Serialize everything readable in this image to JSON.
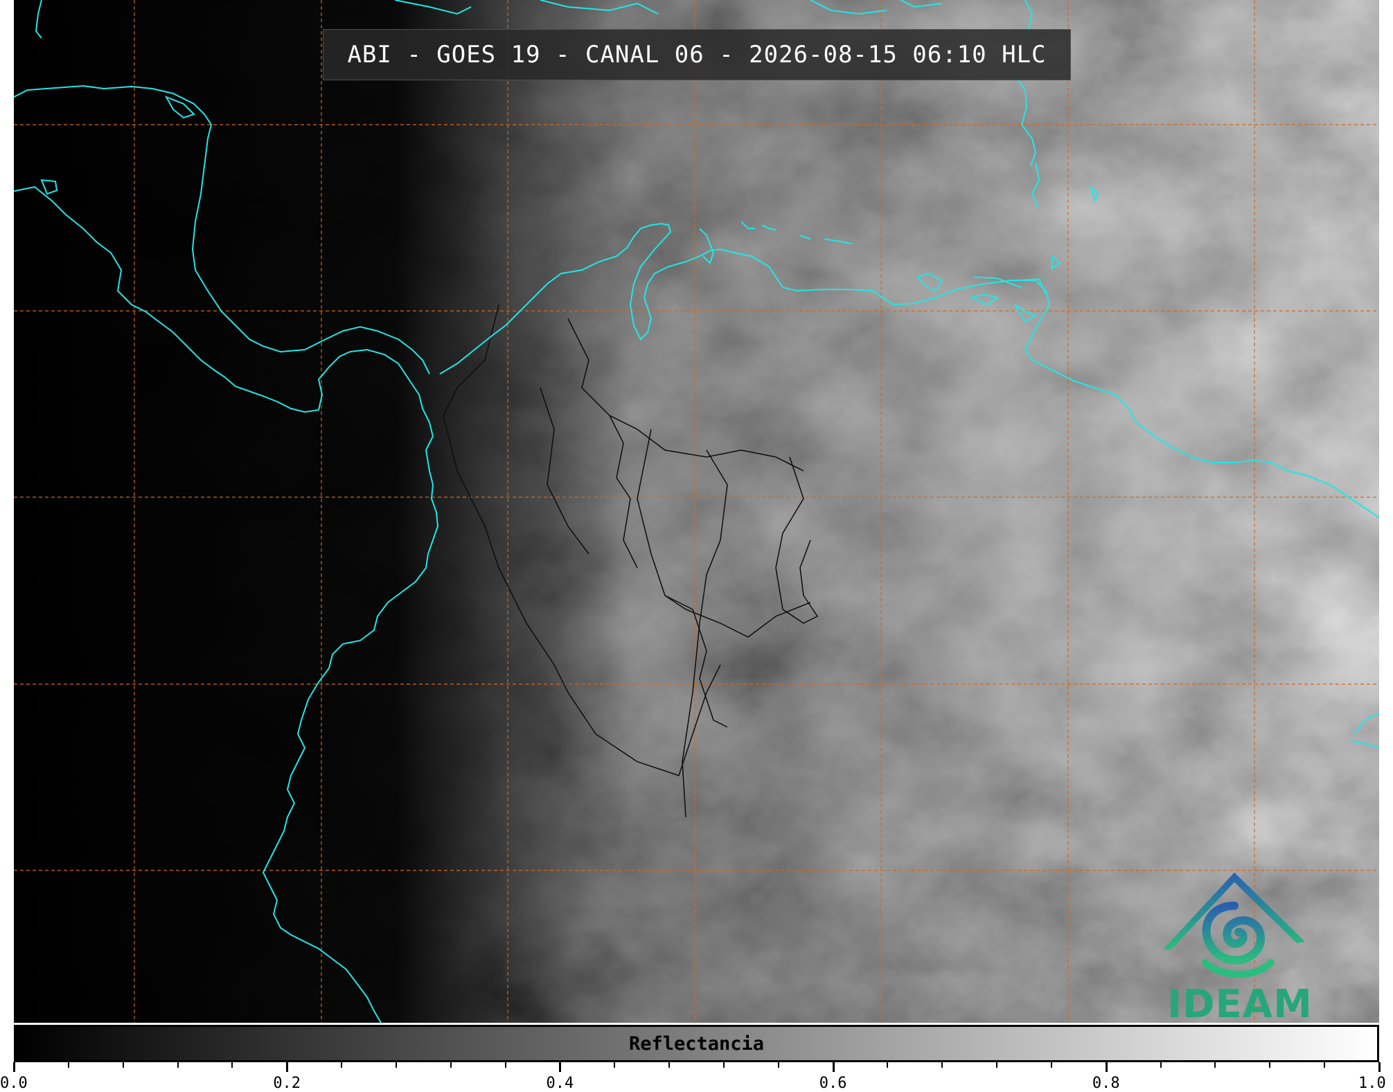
{
  "title": "ABI - GOES 19 - CANAL 06 - 2026-08-15 06:10 HLC",
  "colorbar": {
    "label": "Reflectancia",
    "range": [
      0.0,
      1.0
    ],
    "colormap": [
      "#000000",
      "#ffffff"
    ],
    "ticks": [
      "0.0",
      "0.2",
      "0.4",
      "0.6",
      "0.8",
      "1.0"
    ],
    "minor_ticks_per_interval": 5
  },
  "logo": {
    "text": "IDEAM"
  },
  "colors": {
    "coastline": "#22e6e6",
    "gridline": "#d2691e",
    "borders": "#111111",
    "logo_gradient_top": "#2a5fb0",
    "logo_gradient_bottom": "#2bbd7e"
  },
  "map_layers": {
    "coastlines": "cyan",
    "graticule": "dashed orange",
    "political_boundaries": "thin black"
  }
}
